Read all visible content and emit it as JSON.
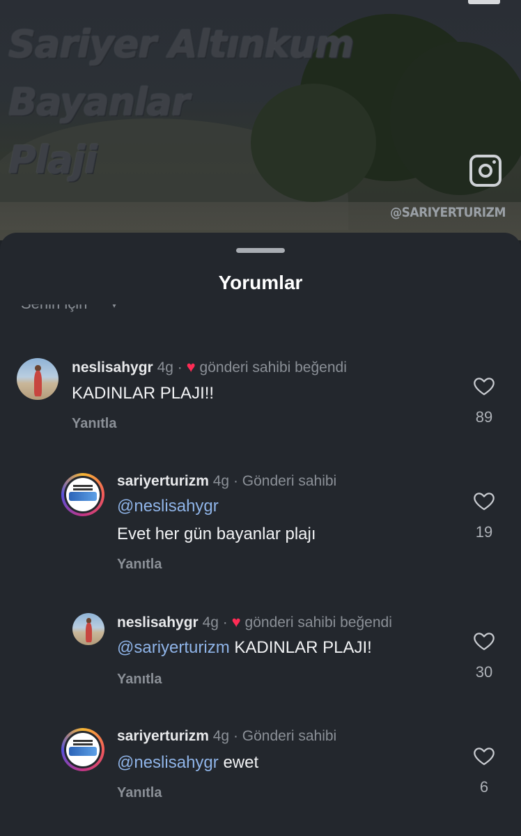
{
  "video": {
    "overlay_title_lines": [
      "Sariyer Altınkum",
      "Bayanlar",
      "Plaji"
    ],
    "watermark_handle": "@SARIYERTURIZM",
    "instagram_icon": "instagram-icon"
  },
  "sheet": {
    "title": "Yorumlar",
    "sort_label": "Senin için",
    "sort_icon": "chevron-down-icon"
  },
  "comments": [
    {
      "username": "neslisahygr",
      "age": "4g",
      "separator": "·",
      "liked_by_creator_label": "gönderi sahibi beğendi",
      "text": "KADINLAR PLAJI!!",
      "reply_label": "Yanıtla",
      "likes": "89"
    },
    {
      "username": "sariyerturizm",
      "age": "4g",
      "separator": "·",
      "creator_label": "Gönderi sahibi",
      "mention": "@neslisahygr",
      "text": "Evet her gün bayanlar plajı",
      "reply_label": "Yanıtla",
      "likes": "19"
    },
    {
      "username": "neslisahygr",
      "age": "4g",
      "separator": "·",
      "liked_by_creator_label": "gönderi sahibi beğendi",
      "mention": "@sariyerturizm",
      "text": "KADINLAR PLAJI!",
      "reply_label": "Yanıtla",
      "likes": "30"
    },
    {
      "username": "sariyerturizm",
      "age": "4g",
      "separator": "·",
      "creator_label": "Gönderi sahibi",
      "mention": "@neslisahygr",
      "text": "ewet",
      "reply_label": "Yanıtla",
      "likes": "6"
    }
  ],
  "colors": {
    "sheet_bg": "#23272d",
    "mention": "#8fb4e8",
    "heart": "#fe2c55",
    "muted_text": "#8b9097"
  }
}
